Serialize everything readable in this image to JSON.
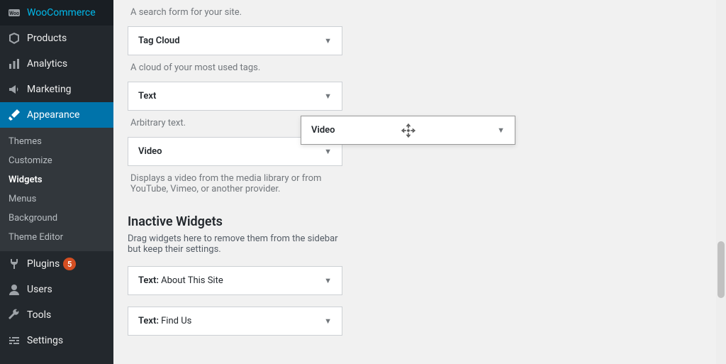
{
  "sidebar": {
    "items": [
      {
        "label": "WooCommerce",
        "icon": "woo"
      },
      {
        "label": "Products",
        "icon": "box"
      },
      {
        "label": "Analytics",
        "icon": "bars"
      },
      {
        "label": "Marketing",
        "icon": "megaphone"
      },
      {
        "label": "Appearance",
        "icon": "brush",
        "active": true
      },
      {
        "label": "Plugins",
        "icon": "plug",
        "badge": "5"
      },
      {
        "label": "Users",
        "icon": "user"
      },
      {
        "label": "Tools",
        "icon": "wrench"
      },
      {
        "label": "Settings",
        "icon": "sliders"
      }
    ],
    "submenu": [
      {
        "label": "Themes"
      },
      {
        "label": "Customize"
      },
      {
        "label": "Widgets",
        "current": true
      },
      {
        "label": "Menus"
      },
      {
        "label": "Background"
      },
      {
        "label": "Theme Editor"
      }
    ]
  },
  "widgets": {
    "desc_search": "A search form for your site.",
    "tag_cloud": "Tag Cloud",
    "desc_tag": "A cloud of your most used tags.",
    "text": "Text",
    "desc_text": "Arbitrary text.",
    "video": "Video",
    "desc_video": "Displays a video from the media library or from YouTube, Vimeo, or another provider."
  },
  "dragging": {
    "label": "Video"
  },
  "inactive": {
    "heading": "Inactive Widgets",
    "desc": "Drag widgets here to remove them from the sidebar but keep their settings.",
    "items": [
      {
        "prefix": "Text:",
        "label": " About This Site"
      },
      {
        "prefix": "Text:",
        "label": " Find Us"
      }
    ]
  }
}
